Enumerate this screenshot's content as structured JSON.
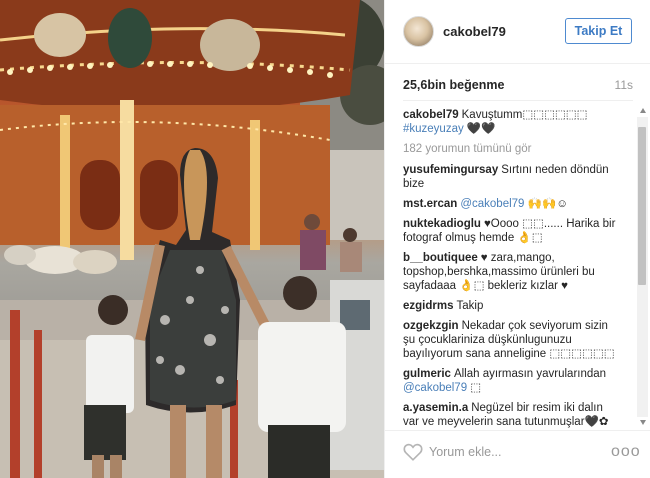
{
  "post": {
    "username": "cakobel79",
    "follow_label": "Takip Et",
    "likes": "25,6bin beğenme",
    "time": "11s",
    "view_all": "182 yorumun tümünü gör",
    "comment_placeholder": "Yorum ekle...",
    "more": "ooo"
  },
  "comments": [
    {
      "user": "cakobel79",
      "pre": "Kavuştumm⬚⬚⬚⬚⬚⬚ ",
      "tag": "#kuzeyuzay",
      "post": " 🖤🖤"
    },
    {
      "user": "yusufemingursay",
      "pre": "Sırtını neden döndün bize",
      "tag": "",
      "post": ""
    },
    {
      "user": "mst.ercan",
      "pre": "",
      "tag": "@cakobel79",
      "post": " 🙌🙌☺"
    },
    {
      "user": "nuktekadioglu",
      "pre": "♥Oooo ⬚⬚...... Harika bir fotograf olmuş hemde 👌⬚",
      "tag": "",
      "post": ""
    },
    {
      "user": "b__boutiquee",
      "pre": "♥ zara,mango, topshop,bershka,massimo ürünleri bu sayfadaaa 👌⬚ bekleriz kızlar ♥",
      "tag": "",
      "post": ""
    },
    {
      "user": "ezgidrms",
      "pre": "Takip",
      "tag": "",
      "post": ""
    },
    {
      "user": "ozgekzgin",
      "pre": "Nekadar çok seviyorum sizin şu çocuklariniza düşkünlugunuzu bayılıyorum sana anneligine ⬚⬚⬚⬚⬚⬚",
      "tag": "",
      "post": ""
    },
    {
      "user": "gulmeric",
      "pre": "Allah ayırmasın yavrularından ",
      "tag": "@cakobel79",
      "post": " ⬚"
    },
    {
      "user": "a.yasemin.a",
      "pre": "Negüzel bir resim iki dalın var ve meyvelerin sana tutunmuşlar🖤✿",
      "tag": "",
      "post": ""
    }
  ],
  "colors": {
    "link": "#4a7fb8",
    "follow_border": "#4e8ad0"
  }
}
